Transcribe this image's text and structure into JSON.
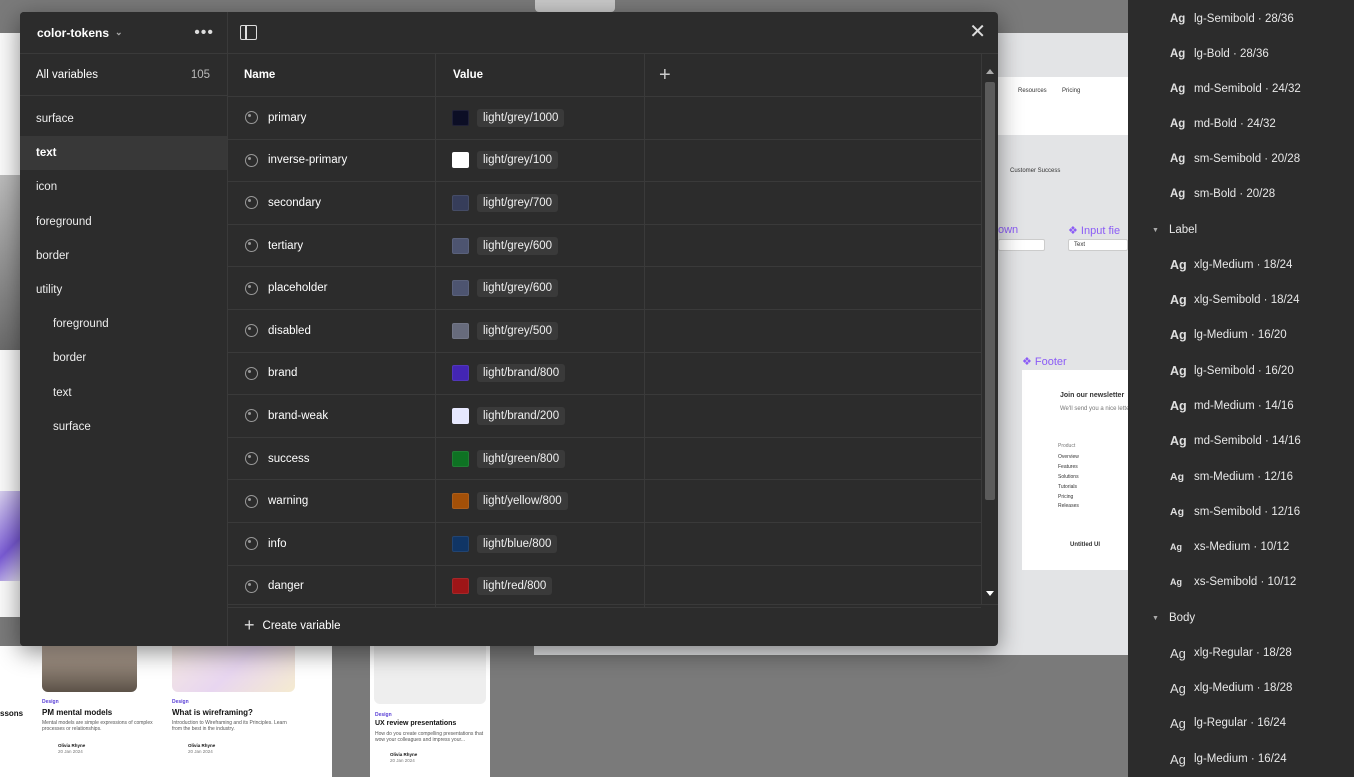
{
  "collection": {
    "name": "color-tokens"
  },
  "sidebar": {
    "all_label": "All variables",
    "all_count": "105",
    "groups": [
      {
        "label": "surface"
      },
      {
        "label": "text"
      },
      {
        "label": "icon"
      },
      {
        "label": "foreground"
      },
      {
        "label": "border"
      },
      {
        "label": "utility"
      },
      {
        "label": "foreground"
      },
      {
        "label": "border"
      },
      {
        "label": "text"
      },
      {
        "label": "surface"
      }
    ]
  },
  "table": {
    "headers": {
      "name": "Name",
      "value": "Value"
    },
    "rows": [
      {
        "name": "primary",
        "value": "light/grey/1000",
        "color": "#0c0e25"
      },
      {
        "name": "inverse-primary",
        "value": "light/grey/100",
        "color": "#ffffff"
      },
      {
        "name": "secondary",
        "value": "light/grey/700",
        "color": "#363d5a"
      },
      {
        "name": "tertiary",
        "value": "light/grey/600",
        "color": "#4d5470"
      },
      {
        "name": "placeholder",
        "value": "light/grey/600",
        "color": "#4d5470"
      },
      {
        "name": "disabled",
        "value": "light/grey/500",
        "color": "#676b7c"
      },
      {
        "name": "brand",
        "value": "light/brand/800",
        "color": "#4325b4"
      },
      {
        "name": "brand-weak",
        "value": "light/brand/200",
        "color": "#e6e8fe"
      },
      {
        "name": "success",
        "value": "light/green/800",
        "color": "#0e7223"
      },
      {
        "name": "warning",
        "value": "light/yellow/800",
        "color": "#a35008"
      },
      {
        "name": "info",
        "value": "light/blue/800",
        "color": "#103565"
      },
      {
        "name": "danger",
        "value": "light/red/800",
        "color": "#9e1517"
      }
    ]
  },
  "create_label": "Create variable",
  "right_panel": {
    "styles_top": [
      "lg-Semibold · 28/36",
      "lg-Bold · 28/36",
      "md-Semibold · 24/32",
      "md-Bold · 24/32",
      "sm-Semibold · 20/28",
      "sm-Bold · 20/28"
    ],
    "label_heading": "Label",
    "label_styles": [
      "xlg-Medium · 18/24",
      "xlg-Semibold · 18/24",
      "lg-Medium · 16/20",
      "lg-Semibold · 16/20",
      "md-Medium · 14/16",
      "md-Semibold · 14/16",
      "sm-Medium · 12/16",
      "sm-Semibold · 12/16",
      "xs-Medium · 10/12",
      "xs-Semibold · 10/12"
    ],
    "body_heading": "Body",
    "body_styles": [
      "xlg-Regular · 18/28",
      "xlg-Medium · 18/28",
      "lg-Regular · 16/24",
      "lg-Medium · 16/24"
    ],
    "ag": "Ag"
  },
  "canvas": {
    "nav_resources": "Resources",
    "nav_pricing": "Pricing",
    "customer_success": "Customer Success",
    "dropdown_frag": "own",
    "input_frag": "❖ Input fie",
    "footer_label": "❖ Footer",
    "newsletter": "Join our newsletter",
    "newsletter_sub": "We'll send you a nice letter",
    "footer_links": [
      "Product",
      "Overview",
      "Features",
      "Solutions",
      "Tutorials",
      "Pricing",
      "Releases"
    ],
    "untitled": "Untitled UI",
    "input_text": "Text",
    "cards": [
      {
        "tag": "Design",
        "title": "PM mental models",
        "desc": "Mental models are simple expressions of complex processes or relationships.",
        "author": "Olivia Rhyne",
        "date": "20 Jan 2024"
      },
      {
        "tag": "Design",
        "title": "What is wireframing?",
        "desc": "Introduction to Wireframing and its Principles. Learn from the best in the industry.",
        "author": "Olivia Rhyne",
        "date": "20 Jan 2024"
      },
      {
        "tag": "Design",
        "title": "UX review presentations",
        "desc": "How do you create compelling presentations that wow your colleagues and impress your...",
        "author": "Olivia Rhyne",
        "date": "20 Jan 2024"
      }
    ],
    "frag_lessons": "ssons"
  }
}
